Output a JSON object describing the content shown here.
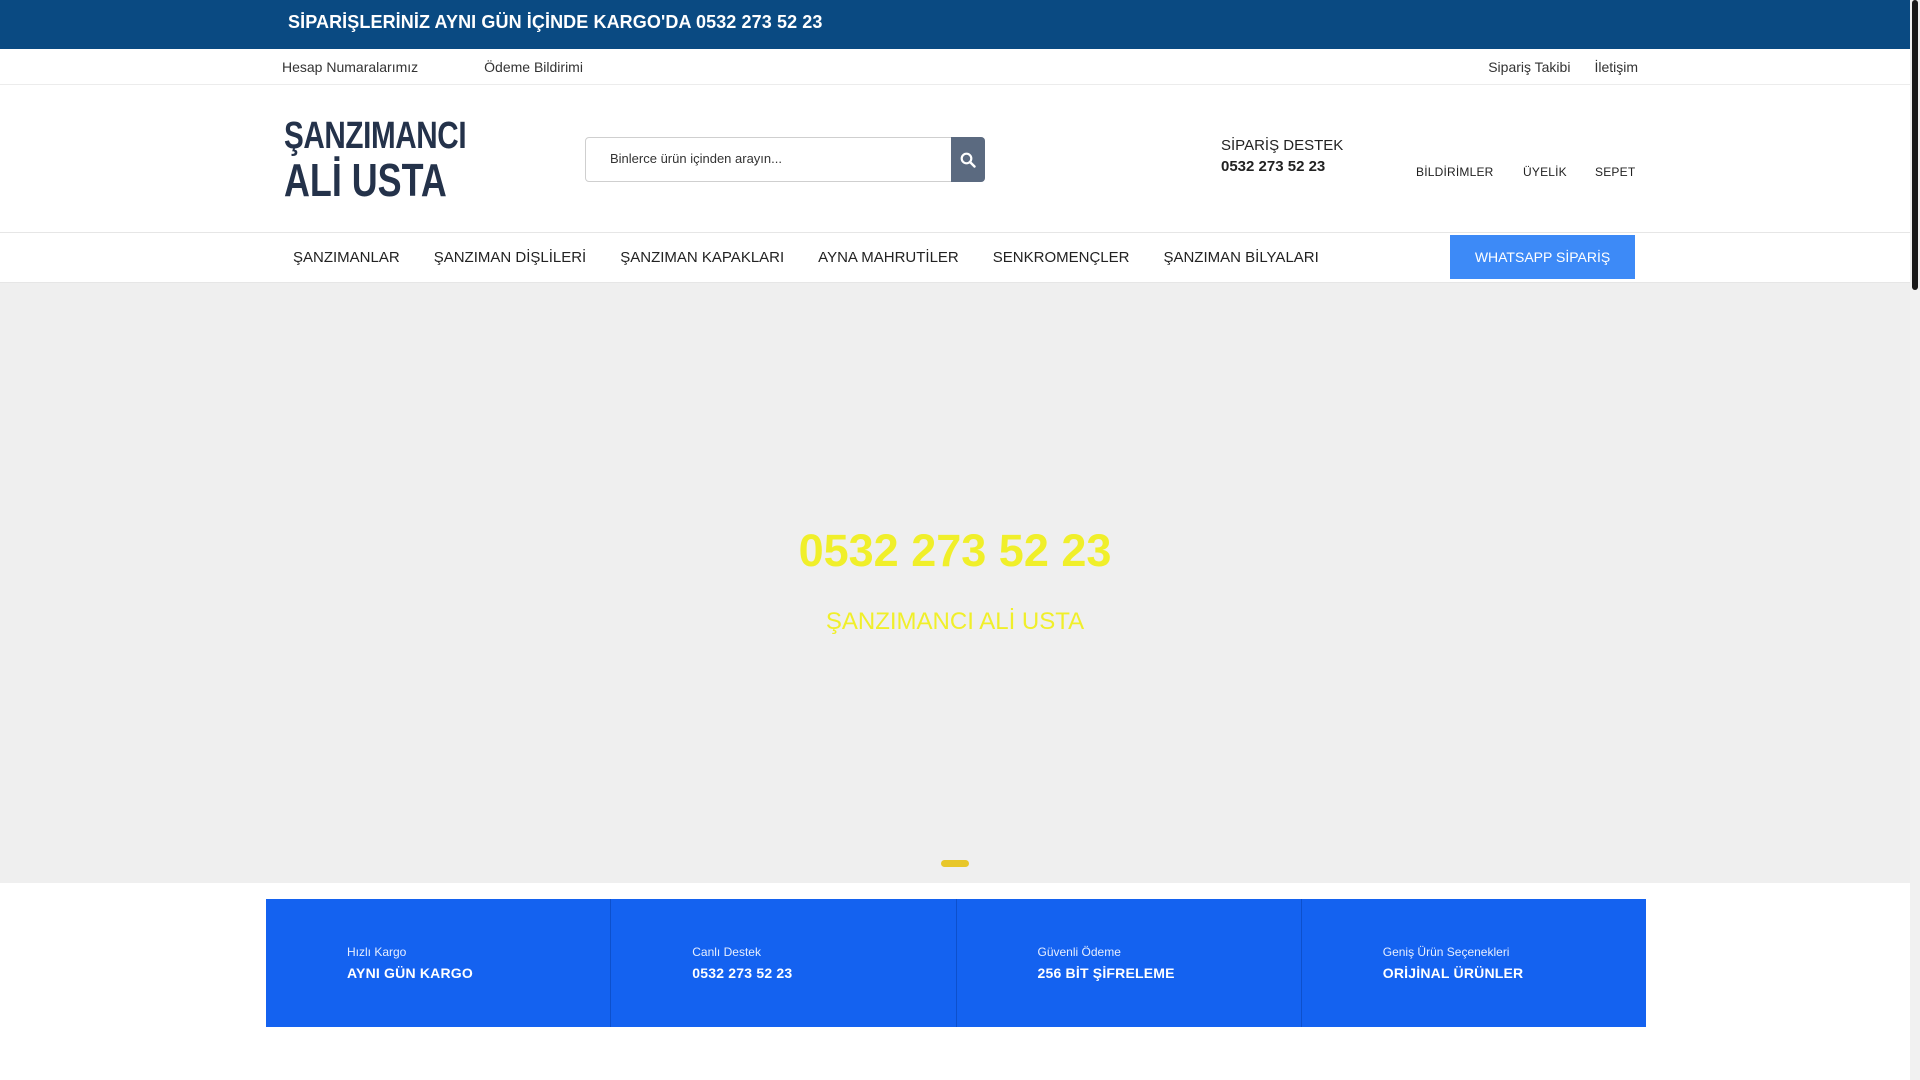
{
  "announcement": {
    "text": "SİPARİŞLERİNİZ AYNI GÜN İÇİNDE KARGO'DA 0532 273 52 23",
    "close_icon": ""
  },
  "toplinks": {
    "left": [
      {
        "label": "Hesap Numaralarımız",
        "icon": ""
      },
      {
        "label": "Ödeme Bildirimi",
        "icon": ""
      }
    ],
    "right": [
      {
        "label": "Sipariş Takibi",
        "icon": ""
      },
      {
        "label": "İletişim",
        "icon": ""
      }
    ]
  },
  "logo": {
    "line1": "ŞANZIMANCI",
    "line2": "ALİ USTA"
  },
  "search": {
    "placeholder": "Binlerce ürün içinden arayın..."
  },
  "support": {
    "icon": "",
    "title": "SİPARİŞ DESTEK",
    "phone": "0532 273 52 23"
  },
  "header_icons": [
    {
      "icon": "",
      "label": "BİLDİRİMLER"
    },
    {
      "icon": "",
      "label": "ÜYELİK"
    },
    {
      "icon": "",
      "label": "SEPET"
    }
  ],
  "nav": {
    "items": [
      "ŞANZIMANLAR",
      "ŞANZIMAN DİŞLİLERİ",
      "ŞANZIMAN KAPAKLARI",
      "AYNA MAHRUTİLER",
      "SENKROMENÇLER",
      "ŞANZIMAN BİLYALARI"
    ],
    "whatsapp": "WHATSAPP SİPARİŞ"
  },
  "hero": {
    "phone": "0532 273 52 23",
    "brand": "ŞANZIMANCI ALİ USTA"
  },
  "features": [
    {
      "icon": "",
      "title": "Hızlı Kargo",
      "value": "AYNI GÜN KARGO"
    },
    {
      "icon": "",
      "title": "Canlı Destek",
      "value": "0532 273 52 23"
    },
    {
      "icon": "",
      "title": "Güvenli Ödeme",
      "value": "256 BİT ŞİFRELEME"
    },
    {
      "icon": "",
      "title": "Geniş Ürün Seçenekleri",
      "value": "ORİJİNAL ÜRÜNLER"
    }
  ],
  "colors": {
    "announce_bg": "#0a4a82",
    "accent_blue": "#1462f0",
    "whatsapp_bg": "#3d8af7",
    "hero_text": "#f0ef2a",
    "hero_bg": "#efefef"
  }
}
